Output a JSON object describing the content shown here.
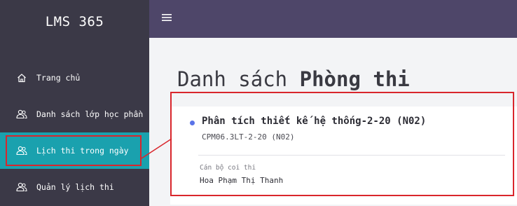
{
  "app": {
    "title": "LMS 365"
  },
  "sidebar": {
    "items": [
      {
        "label": "Trang chủ",
        "icon": "home-icon",
        "active": false
      },
      {
        "label": "Danh sách lớp học phần",
        "icon": "users-icon",
        "active": false
      },
      {
        "label": "Lịch thi trong ngày",
        "icon": "users-icon",
        "active": true
      },
      {
        "label": "Quản lý lịch thi",
        "icon": "users-icon",
        "active": false
      }
    ]
  },
  "topbar": {
    "menu_icon": "hamburger-icon"
  },
  "main": {
    "title_regular": "Danh sách ",
    "title_bold": "Phòng thi",
    "exam_card": {
      "course_name": "Phân tích thiết kế hệ thống-2-20 (N02)",
      "course_code": "CPM06.3LT-2-20 (N02)",
      "proctor_label": "Cán bộ coi thi",
      "proctor_name": "Hoa Phạm Thị Thanh"
    }
  },
  "colors": {
    "sidebar_bg": "#3b3947",
    "active_item": "#1aa1ae",
    "topbar_bg": "#4e4669",
    "highlight_red": "#d9262c",
    "bullet_blue": "#5a73e8"
  }
}
